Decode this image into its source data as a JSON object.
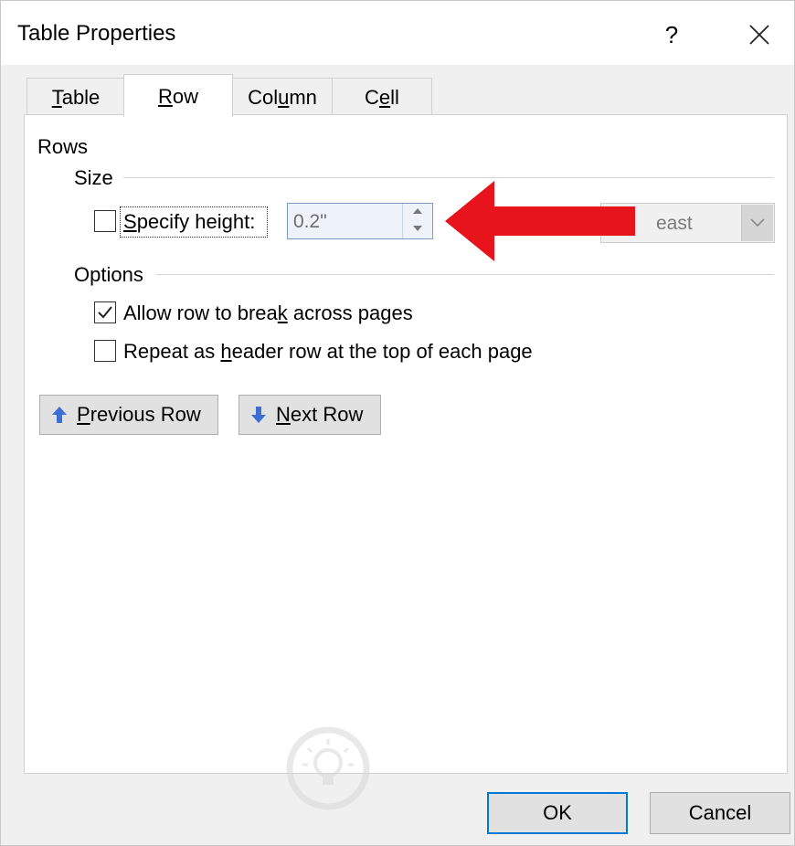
{
  "window": {
    "title": "Table Properties",
    "help_label": "?",
    "close_label": "✕"
  },
  "tabs": [
    {
      "label": "Table",
      "mnemonic": "T",
      "rest": "able",
      "active": false
    },
    {
      "label": "Row",
      "mnemonic": "R",
      "rest": "ow",
      "active": true
    },
    {
      "label": "Column",
      "pre": "Col",
      "mnemonic": "u",
      "rest": "mn",
      "active": false
    },
    {
      "label": "Cell",
      "pre": "C",
      "mnemonic": "e",
      "rest": "ll",
      "active": false
    }
  ],
  "rows_section": {
    "title": "Rows",
    "size_group": {
      "title": "Size",
      "specify_height": {
        "checked": false,
        "label_mnemonic": "S",
        "label_rest": "pecify height:",
        "value": "0.2\"",
        "row_height_is_value": "east"
      }
    },
    "options_group": {
      "title": "Options",
      "allow_break": {
        "checked": true,
        "label_pre": "Allow row to brea",
        "label_mnemonic": "k",
        "label_rest": " across pages"
      },
      "repeat_header": {
        "checked": false,
        "label_pre": "Repeat as ",
        "label_mnemonic": "h",
        "label_rest": "eader row at the top of each page"
      }
    }
  },
  "nav_buttons": {
    "previous": {
      "mnemonic": "P",
      "rest": "revious Row"
    },
    "next": {
      "mnemonic": "N",
      "rest": "ext Row"
    }
  },
  "footer": {
    "ok_label": "OK",
    "cancel_label": "Cancel"
  },
  "colors": {
    "annotation_arrow": "#e8141b",
    "nav_arrow": "#3b6fd6",
    "focus_border": "#0078d7"
  }
}
